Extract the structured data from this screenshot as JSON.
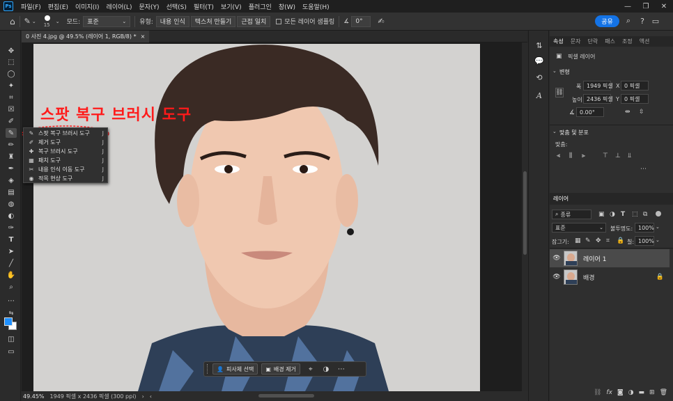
{
  "menubar": {
    "logo": "Ps",
    "items": [
      "파일(F)",
      "편집(E)",
      "이미지(I)",
      "레이어(L)",
      "문자(Y)",
      "선택(S)",
      "필터(T)",
      "보기(V)",
      "플러그인",
      "창(W)",
      "도움말(H)"
    ],
    "window_controls": [
      "—",
      "❐",
      "✕"
    ]
  },
  "options": {
    "brush_size": "15",
    "mode_label": "모드:",
    "mode_value": "표준",
    "type_label": "유형:",
    "type_buttons": [
      "내용 인식",
      "텍스처 만들기",
      "근접 일치"
    ],
    "sample_all_label": "모든 레이어 샘플링",
    "angle_value": "0°",
    "share_label": "공유"
  },
  "document": {
    "tab_title": "0 사진 4.jpg @ 49.5% (레이어 1, RGB/8) *",
    "tab_close": "×"
  },
  "status": {
    "zoom": "49.45%",
    "info": "1949 픽셀 x 2436 픽셀 (300 ppi)"
  },
  "annotation": {
    "text": "스팟 복구 브러시 도구",
    "color": "#ff1a1a"
  },
  "flyout": {
    "items": [
      {
        "label": "스팟 복구 브러시 도구",
        "key": "J",
        "icon": "spot-healing-brush-icon"
      },
      {
        "label": "제거 도구",
        "key": "J",
        "icon": "remove-tool-icon"
      },
      {
        "label": "복구 브러시 도구",
        "key": "J",
        "icon": "healing-brush-icon"
      },
      {
        "label": "패치 도구",
        "key": "J",
        "icon": "patch-tool-icon"
      },
      {
        "label": "내용 인식 이동 도구",
        "key": "J",
        "icon": "content-aware-move-icon"
      },
      {
        "label": "적목 현상 도구",
        "key": "J",
        "icon": "red-eye-tool-icon"
      }
    ]
  },
  "context_bar": {
    "select_subject": "피사체 선택",
    "remove_bg": "배경 제거"
  },
  "properties": {
    "tabs": [
      "속성",
      "문자",
      "단락",
      "패스",
      "조정",
      "액션"
    ],
    "active_tab": "속성",
    "layer_type": "픽셀 레이어",
    "transform_header": "변형",
    "width_label": "폭",
    "width_value": "1949 픽셀",
    "height_label": "높이",
    "height_value": "2436 픽셀",
    "x_label": "X",
    "x_value": "0 픽셀",
    "y_label": "Y",
    "y_value": "0 픽셀",
    "angle_value": "0.00°",
    "align_header": "맞춤 및 분포",
    "align_label": "맞춤:"
  },
  "layers": {
    "tab": "레이어",
    "filter_value": "종류",
    "blend_mode": "표준",
    "opacity_label": "불투명도:",
    "opacity_value": "100%",
    "lock_label": "잠그기:",
    "fill_label": "칠:",
    "fill_value": "100%",
    "items": [
      {
        "name": "레이어 1",
        "selected": true,
        "locked": false
      },
      {
        "name": "배경",
        "selected": false,
        "locked": true
      }
    ],
    "footer_icons": [
      "link-icon",
      "fx-icon",
      "mask-icon",
      "adjustment-icon",
      "group-icon",
      "new-layer-icon",
      "trash-icon"
    ]
  },
  "colors": {
    "accent": "#1473e6",
    "foreground": "#1e90ff",
    "background": "#ffffff"
  }
}
